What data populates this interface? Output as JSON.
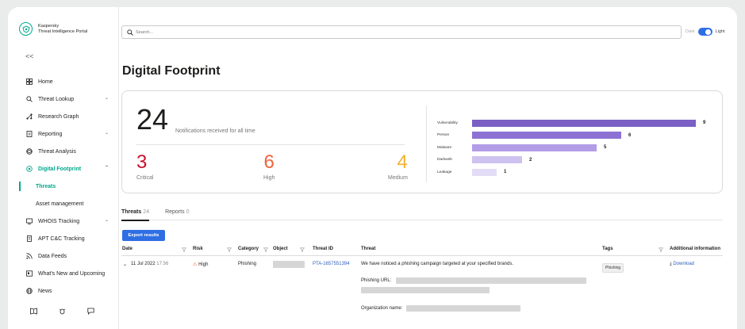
{
  "brand": {
    "line1": "Kaspersky",
    "line2": "Threat Intelligence Portal",
    "icon": "kaspersky-shield-icon"
  },
  "sidebar": {
    "collapse_label": "<<",
    "items": [
      {
        "label": "Home",
        "icon": "home-grid-icon"
      },
      {
        "label": "Threat Lookup",
        "icon": "search-icon",
        "expandable": true
      },
      {
        "label": "Research Graph",
        "icon": "graph-icon"
      },
      {
        "label": "Reporting",
        "icon": "report-icon",
        "expandable": true
      },
      {
        "label": "Threat Analysis",
        "icon": "analysis-icon"
      },
      {
        "label": "Digital Footprint",
        "icon": "footprint-icon",
        "expandable": true,
        "active": true
      },
      {
        "label": "Threats"
      },
      {
        "label": "Asset management"
      },
      {
        "label": "WHOIS Tracking",
        "icon": "whois-icon",
        "expandable": true
      },
      {
        "label": "APT C&C Tracking",
        "icon": "apt-icon"
      },
      {
        "label": "Data Feeds",
        "icon": "feeds-icon"
      },
      {
        "label": "What's New and Upcoming",
        "icon": "news-box-icon"
      },
      {
        "label": "News",
        "icon": "globe-icon"
      }
    ],
    "bottom_icons": [
      "book-icon",
      "bug-icon",
      "chat-icon"
    ]
  },
  "search": {
    "placeholder": "Search..."
  },
  "theme": {
    "dark": "Dark",
    "light": "Light",
    "selected": "Light"
  },
  "page": {
    "title": "Digital Footprint"
  },
  "summary": {
    "total": "24",
    "total_desc": "Notifications received for all time",
    "stats": [
      {
        "value": "3",
        "label": "Critical",
        "color": "#c8102e"
      },
      {
        "value": "6",
        "label": "High",
        "color": "#f2633a"
      },
      {
        "value": "4",
        "label": "Medium",
        "color": "#f4b233"
      }
    ],
    "breakdown": [
      {
        "label": "Vulnerability",
        "value": 9,
        "color": "#7a5fc4"
      },
      {
        "label": "Person",
        "value": 6,
        "color": "#8d71d3"
      },
      {
        "label": "Malware",
        "value": 5,
        "color": "#b29de6"
      },
      {
        "label": "Darkweb",
        "value": 2,
        "color": "#cec2f0"
      },
      {
        "label": "Leakage",
        "value": 1,
        "color": "#e3dcf6"
      }
    ]
  },
  "tabs": [
    {
      "label": "Threats",
      "count": "24",
      "active": true
    },
    {
      "label": "Reports",
      "count": "0",
      "active": false
    }
  ],
  "export_label": "Export results",
  "table": {
    "headers": [
      "Date",
      "Risk",
      "Category",
      "Object",
      "Threat ID",
      "Threat",
      "Tags",
      "Additional information"
    ],
    "row": {
      "date": "11 Jul 2022",
      "time": "17:56",
      "risk": "High",
      "category": "Phishing",
      "threat_id": "PTA-1657551394",
      "threat": "We have noticed a phishing campaign targeted at your specified brands.",
      "phishing_url_label": "Phishing URL:",
      "org_label": "Organization name:",
      "tag": "Phishing",
      "download": "Download"
    }
  }
}
